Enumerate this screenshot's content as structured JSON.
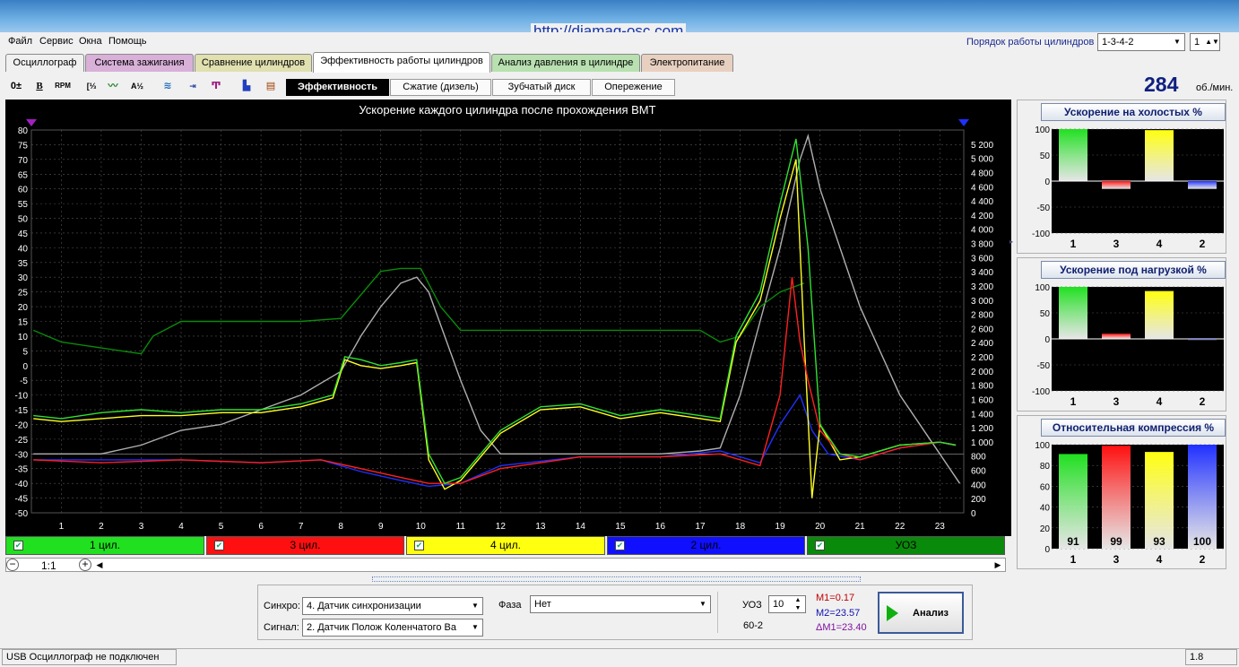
{
  "window": {
    "url": "http://diamag-osc.com"
  },
  "menu": [
    "Файл",
    "Сервис",
    "Окна",
    "Помощь"
  ],
  "firing_order": {
    "label": "Порядок работы цилиндров",
    "value": "1-3-4-2",
    "spinner": "1"
  },
  "tabs": [
    {
      "label": "Осциллограф",
      "color": "#f0f0f0"
    },
    {
      "label": "Система зажигания",
      "color": "#d8b0d8"
    },
    {
      "label": "Сравнение цилиндров",
      "color": "#e0e0b0"
    },
    {
      "label": "Эффективность работы цилиндров",
      "color": "#ffffff",
      "active": true
    },
    {
      "label": "Анализ давления в цилиндре",
      "color": "#b8e0b0"
    },
    {
      "label": "Электропитание",
      "color": "#e8d0c0"
    }
  ],
  "toolbar": {
    "icons": [
      "offset-icon",
      "bold-icon",
      "rpm-icon",
      "scale-icon",
      "wave-icon",
      "algorithm-icon",
      "filter-icon",
      "counter-icon",
      "marker-icon",
      "bars-icon",
      "table-icon"
    ],
    "subtabs": [
      "Эффективность",
      "Сжатие (дизель)",
      "Зубчатый диск",
      "Опережение"
    ],
    "active_subtab": "Эффективность"
  },
  "rpm": {
    "value": "284",
    "unit": "об./мин."
  },
  "chart_data": {
    "type": "line",
    "title": "Ускорение каждого цилиндра после прохождения ВМТ",
    "x_ticks": [
      "1",
      "2",
      "3",
      "4",
      "5",
      "6",
      "7",
      "8",
      "9",
      "10",
      "11",
      "12",
      "13",
      "14",
      "15",
      "16",
      "17",
      "18",
      "19",
      "20",
      "21",
      "22",
      "23"
    ],
    "xlim": [
      0.25,
      23.6
    ],
    "y_left": {
      "ticks": [
        "80",
        "75",
        "70",
        "65",
        "60",
        "55",
        "50",
        "45",
        "40",
        "35",
        "30",
        "25",
        "20",
        "15",
        "10",
        "5",
        "0",
        "-5",
        "-10",
        "-15",
        "-20",
        "-25",
        "-30",
        "-35",
        "-40",
        "-45",
        "-50"
      ],
      "ylim": [
        -50,
        80
      ]
    },
    "y_right": {
      "ticks": [
        "5 200",
        "5 000",
        "4 800",
        "4 600",
        "4 400",
        "4 200",
        "4 000",
        "3 800",
        "3 600",
        "3 400",
        "3 200",
        "3 000",
        "2 800",
        "2 600",
        "2 400",
        "2 200",
        "2 000",
        "1 800",
        "1 600",
        "1 400",
        "1 200",
        "1 000",
        "800",
        "600",
        "400",
        "200",
        "0"
      ],
      "ylim": [
        0,
        5400
      ]
    },
    "series": [
      {
        "name": "1 цил.",
        "color": "#30e030",
        "x": [
          0.3,
          1,
          2,
          3,
          4,
          5,
          6,
          7,
          7.8,
          8.1,
          8.5,
          9,
          9.5,
          9.9,
          10.2,
          10.6,
          11,
          12,
          13,
          14,
          15,
          16,
          17,
          17.5,
          17.9,
          18.5,
          19,
          19.4,
          19.7,
          20,
          20.5,
          21,
          22,
          23,
          23.4
        ],
        "y": [
          -17,
          -18,
          -16,
          -15,
          -16,
          -15,
          -15,
          -13,
          -10,
          3,
          2,
          0,
          1,
          2,
          -30,
          -40,
          -38,
          -22,
          -14,
          -13,
          -17,
          -15,
          -17,
          -18,
          10,
          25,
          55,
          77,
          40,
          -20,
          -30,
          -31,
          -27,
          -26,
          -27
        ]
      },
      {
        "name": "3 цил.",
        "color": "#ff2020",
        "x": [
          0.3,
          2,
          4,
          6,
          7.5,
          8.5,
          9.5,
          10.2,
          11,
          12,
          14,
          16,
          17.5,
          18.5,
          19,
          19.3,
          19.5,
          19.7,
          20,
          20.5,
          21,
          22,
          23,
          23.4
        ],
        "y": [
          -32,
          -33,
          -32,
          -33,
          -32,
          -35,
          -38,
          -40,
          -40,
          -35,
          -31,
          -31,
          -30,
          -34,
          -10,
          30,
          8,
          -5,
          -22,
          -30,
          -32,
          -28,
          -26,
          -27
        ]
      },
      {
        "name": "4 цил.",
        "color": "#ffff20",
        "x": [
          0.3,
          1,
          2,
          3,
          4,
          5,
          6,
          7,
          7.8,
          8.1,
          8.5,
          9,
          9.5,
          9.9,
          10.2,
          10.6,
          11,
          12,
          13,
          14,
          15,
          16,
          17,
          17.5,
          17.9,
          18.5,
          19,
          19.4,
          19.6,
          19.8,
          20,
          20.5,
          21,
          22,
          23,
          23.4
        ],
        "y": [
          -18,
          -19,
          -18,
          -17,
          -17,
          -16,
          -16,
          -14,
          -11,
          2,
          0,
          -1,
          0,
          1,
          -32,
          -42,
          -39,
          -23,
          -15,
          -14,
          -18,
          -16,
          -18,
          -19,
          8,
          22,
          50,
          70,
          10,
          -45,
          -20,
          -32,
          -31,
          -27,
          -26,
          -27
        ]
      },
      {
        "name": "2 цил.",
        "color": "#2030ff",
        "x": [
          0.3,
          2,
          4,
          6,
          7.5,
          8.5,
          9.5,
          10.2,
          11,
          12,
          14,
          16,
          17.5,
          18.5,
          19,
          19.5,
          19.8,
          20.2,
          21,
          22,
          23,
          23.4
        ],
        "y": [
          -32,
          -32,
          -32,
          -33,
          -32,
          -36,
          -39,
          -41,
          -40,
          -34,
          -31,
          -31,
          -29,
          -33,
          -20,
          -10,
          -22,
          -30,
          -32,
          -28,
          -26,
          -27
        ]
      },
      {
        "name": "УОЗ",
        "color": "#0a8a0a",
        "x": [
          0.3,
          1,
          2,
          3,
          3.3,
          4,
          5,
          6,
          7,
          8,
          9,
          9.5,
          10,
          10.5,
          11,
          12,
          13,
          14,
          15,
          16,
          17,
          17.5,
          18,
          18.5,
          19,
          19.4,
          19.6
        ],
        "y": [
          12,
          8,
          6,
          4,
          10,
          15,
          15,
          15,
          15,
          16,
          32,
          33,
          33,
          20,
          12,
          12,
          12,
          12,
          12,
          12,
          12,
          8,
          10,
          20,
          25,
          27,
          28
        ]
      },
      {
        "name": "rpm",
        "color": "#b0b0b0",
        "x": [
          0.3,
          2,
          3,
          4,
          5,
          6,
          7,
          8,
          8.5,
          9,
          9.5,
          9.9,
          10.2,
          10.6,
          11,
          11.5,
          12,
          13,
          14,
          15,
          16,
          17,
          17.5,
          18,
          18.5,
          19,
          19.5,
          19.7,
          20,
          21,
          22,
          23,
          23.5
        ],
        "y": [
          -30,
          -30,
          -27,
          -22,
          -20,
          -15,
          -10,
          -2,
          10,
          20,
          28,
          30,
          25,
          10,
          -5,
          -22,
          -30,
          -30,
          -30,
          -30,
          -30,
          -29,
          -28,
          -10,
          15,
          40,
          70,
          78,
          60,
          20,
          -10,
          -30,
          -40
        ]
      }
    ]
  },
  "zoom": "1:1",
  "legend": [
    {
      "label": "1 цил.",
      "color": "#20e020"
    },
    {
      "label": "3 цил.",
      "color": "#ff1010"
    },
    {
      "label": "4 цил.",
      "color": "#ffff10"
    },
    {
      "label": "2 цил.",
      "color": "#1010ff"
    },
    {
      "label": "УОЗ",
      "color": "#0a8a0a"
    }
  ],
  "side_panels": [
    {
      "title": "Ускорение на холостых %",
      "ticks": [
        "100",
        "50",
        "0",
        "-50",
        "-100"
      ],
      "ylim": [
        -100,
        100
      ],
      "bars": [
        {
          "label": "1",
          "value": 100,
          "color": "#20e020"
        },
        {
          "label": "3",
          "value": -15,
          "color": "#ff1010"
        },
        {
          "label": "4",
          "value": 98,
          "color": "#ffff10"
        },
        {
          "label": "2",
          "value": -15,
          "color": "#2030ff"
        }
      ]
    },
    {
      "title": "Ускорение под нагрузкой %",
      "ticks": [
        "100",
        "50",
        "0",
        "-50",
        "-100"
      ],
      "ylim": [
        -100,
        100
      ],
      "bars": [
        {
          "label": "1",
          "value": 100,
          "color": "#20e020"
        },
        {
          "label": "3",
          "value": 10,
          "color": "#ff1010"
        },
        {
          "label": "4",
          "value": 92,
          "color": "#ffff10"
        },
        {
          "label": "2",
          "value": -2,
          "color": "#2030ff"
        }
      ]
    },
    {
      "title": "Относительная компрессия %",
      "ticks": [
        "100",
        "80",
        "60",
        "40",
        "20",
        "0"
      ],
      "ylim": [
        0,
        100
      ],
      "bars": [
        {
          "label": "1",
          "value": 91,
          "color": "#20e020",
          "text": "91"
        },
        {
          "label": "3",
          "value": 99,
          "color": "#ff1010",
          "text": "99"
        },
        {
          "label": "4",
          "value": 93,
          "color": "#ffff10",
          "text": "93"
        },
        {
          "label": "2",
          "value": 100,
          "color": "#2030ff",
          "text": "100"
        }
      ]
    }
  ],
  "bottom": {
    "sync_label": "Синхро:",
    "sync_value": "4.  Датчик синхронизации",
    "signal_label": "Сигнал:",
    "signal_value": "2.  Датчик Полож Коленчатого Ва",
    "phase_label": "Фаза",
    "phase_value": "Нет",
    "uoz_label": "УОЗ",
    "uoz_value": "10",
    "uoz_sub": "60-2",
    "m1": "M1=0.17",
    "m2": "M2=23.57",
    "dm1": "ΔM1=23.40",
    "analyze": "Анализ"
  },
  "status": {
    "left": "USB Осциллограф не подключен",
    "right": "1.8"
  }
}
